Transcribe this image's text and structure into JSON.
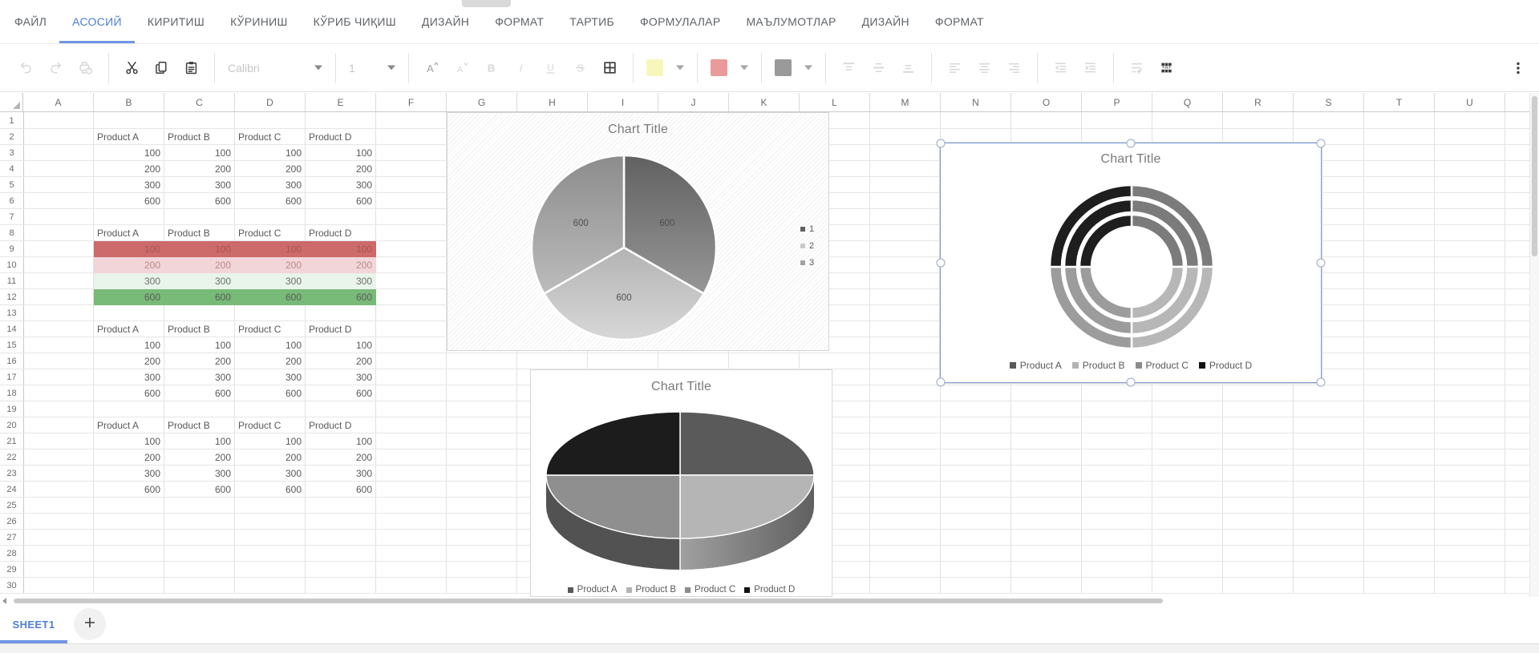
{
  "menu": {
    "active_color": "#4d7cd6",
    "underline_color": "#7295e3",
    "items": [
      {
        "label": "ФАЙЛ",
        "name": "file",
        "active": false
      },
      {
        "label": "АСОСИЙ",
        "name": "home",
        "active": true
      },
      {
        "label": "КИРИТИШ",
        "name": "insert",
        "active": false
      },
      {
        "label": "КЎРИНИШ",
        "name": "view",
        "active": false
      },
      {
        "label": "КЎРИБ ЧИҚИШ",
        "name": "review",
        "active": false
      },
      {
        "label": "ДИЗАЙН",
        "name": "design",
        "active": false
      },
      {
        "label": "ФОРМАТ",
        "name": "format",
        "active": false
      },
      {
        "label": "ТАРТИБ",
        "name": "arrange",
        "active": false
      },
      {
        "label": "ФОРМУЛАЛАР",
        "name": "formulas",
        "active": false
      },
      {
        "label": "МАЪЛУМОТЛАР",
        "name": "data",
        "active": false
      },
      {
        "label": "ДИЗАЙН",
        "name": "design-2",
        "active": false
      },
      {
        "label": "ФОРМАТ",
        "name": "format-2",
        "active": false
      }
    ]
  },
  "toolbar": {
    "font_name": "Calibri",
    "font_size": "1",
    "swatches": {
      "highlight": "#f7f7bb",
      "font_color": "#ea9a9a",
      "shape_fill": "#9a9a9a"
    },
    "groups": [
      {
        "items": [
          {
            "type": "icon",
            "icon": "undo",
            "name": "undo-button",
            "disabled": true
          },
          {
            "type": "icon",
            "icon": "redo",
            "name": "redo-button",
            "disabled": true
          },
          {
            "type": "icon",
            "icon": "print-help",
            "name": "print-help-button",
            "disabled": true
          }
        ]
      },
      {
        "items": [
          {
            "type": "icon",
            "icon": "cut",
            "name": "cut-button",
            "disabled": false
          },
          {
            "type": "icon",
            "icon": "copy",
            "name": "copy-button",
            "disabled": false
          },
          {
            "type": "icon",
            "icon": "paste",
            "name": "paste-button",
            "disabled": false
          }
        ]
      },
      {
        "items": [
          {
            "type": "select",
            "bind": "toolbar.font_name",
            "name": "font-name-select",
            "disabled": true
          }
        ]
      },
      {
        "items": [
          {
            "type": "select",
            "bind": "toolbar.font_size",
            "name": "font-size-select",
            "disabled": true
          }
        ]
      },
      {
        "items": [
          {
            "type": "icon",
            "icon": "font-increase",
            "name": "increase-font-button",
            "disabled": true
          },
          {
            "type": "icon",
            "icon": "font-decrease",
            "name": "decrease-font-button",
            "disabled": true
          },
          {
            "type": "icon",
            "icon": "bold",
            "name": "bold-button",
            "disabled": true
          },
          {
            "type": "icon",
            "icon": "italic",
            "name": "italic-button",
            "disabled": true
          },
          {
            "type": "icon",
            "icon": "underline",
            "name": "underline-button",
            "disabled": true
          },
          {
            "type": "icon",
            "icon": "strikethrough",
            "name": "strikethrough-button",
            "disabled": true
          },
          {
            "type": "icon",
            "icon": "borders",
            "name": "borders-button",
            "disabled": false
          }
        ]
      },
      {
        "items": [
          {
            "type": "swatch",
            "swatch": "highlight",
            "name": "highlight-color-button"
          }
        ]
      },
      {
        "items": [
          {
            "type": "swatch",
            "swatch": "font_color",
            "name": "font-color-button"
          }
        ]
      },
      {
        "items": [
          {
            "type": "swatch",
            "swatch": "shape_fill",
            "name": "shape-fill-color-button"
          }
        ]
      },
      {
        "items": [
          {
            "type": "icon",
            "icon": "valign-top",
            "name": "vertical-align-top-button",
            "disabled": true
          },
          {
            "type": "icon",
            "icon": "valign-middle",
            "name": "vertical-align-middle-button",
            "disabled": true
          },
          {
            "type": "icon",
            "icon": "valign-bottom",
            "name": "vertical-align-bottom-button",
            "disabled": true
          }
        ]
      },
      {
        "items": [
          {
            "type": "icon",
            "icon": "align-left",
            "name": "align-left-button",
            "disabled": true
          },
          {
            "type": "icon",
            "icon": "align-center",
            "name": "align-center-button",
            "disabled": true
          },
          {
            "type": "icon",
            "icon": "align-right",
            "name": "align-right-button",
            "disabled": true
          }
        ]
      },
      {
        "items": [
          {
            "type": "icon",
            "icon": "indent-decrease",
            "name": "indent-decrease-button",
            "disabled": true
          },
          {
            "type": "icon",
            "icon": "indent-increase",
            "name": "indent-increase-button",
            "disabled": true
          }
        ]
      },
      {
        "items": [
          {
            "type": "icon",
            "icon": "wrap-text",
            "name": "wrap-text-button",
            "disabled": true
          },
          {
            "type": "icon",
            "icon": "merge-cells",
            "name": "merge-cells-button",
            "disabled": false
          }
        ]
      }
    ]
  },
  "sheet": {
    "column_headers": [
      "A",
      "B",
      "C",
      "D",
      "E",
      "F",
      "G",
      "H",
      "I",
      "J",
      "K",
      "L",
      "M",
      "N",
      "O",
      "P",
      "Q",
      "R",
      "S",
      "T",
      "U"
    ],
    "visible_rows": 30,
    "product_headers": [
      "Product A",
      "Product B",
      "Product C",
      "Product D"
    ],
    "tables": [
      {
        "name": "table-1",
        "header_row": 2,
        "columns": [
          "B",
          "C",
          "D",
          "E"
        ],
        "rows": [
          {
            "row": 3,
            "values": [
              100,
              100,
              100,
              100
            ]
          },
          {
            "row": 4,
            "values": [
              200,
              200,
              200,
              200
            ]
          },
          {
            "row": 5,
            "values": [
              300,
              300,
              300,
              300
            ]
          },
          {
            "row": 6,
            "values": [
              600,
              600,
              600,
              600
            ]
          }
        ]
      },
      {
        "name": "table-2-conditional-formatting",
        "header_row": 8,
        "columns": [
          "B",
          "C",
          "D",
          "E"
        ],
        "rows": [
          {
            "row": 9,
            "values": [
              100,
              100,
              100,
              100
            ],
            "bg": "#cd6a6a",
            "fg": "#aa5555"
          },
          {
            "row": 10,
            "values": [
              200,
              200,
              200,
              200
            ],
            "bg": "#f2d5d8",
            "fg": "#bb8a8a"
          },
          {
            "row": 11,
            "values": [
              300,
              300,
              300,
              300
            ],
            "bg": "#e9f4ea",
            "fg": "#6d6d6d"
          },
          {
            "row": 12,
            "values": [
              600,
              600,
              600,
              600
            ],
            "bg": "#78ba78",
            "fg": "#5c5c5c"
          }
        ]
      },
      {
        "name": "table-3",
        "header_row": 14,
        "columns": [
          "B",
          "C",
          "D",
          "E"
        ],
        "rows": [
          {
            "row": 15,
            "values": [
              100,
              100,
              100,
              100
            ]
          },
          {
            "row": 16,
            "values": [
              200,
              200,
              200,
              200
            ]
          },
          {
            "row": 17,
            "values": [
              300,
              300,
              300,
              300
            ]
          },
          {
            "row": 18,
            "values": [
              600,
              600,
              600,
              600
            ]
          }
        ]
      },
      {
        "name": "table-4",
        "header_row": 20,
        "columns": [
          "B",
          "C",
          "D",
          "E"
        ],
        "rows": [
          {
            "row": 21,
            "values": [
              100,
              100,
              100,
              100
            ]
          },
          {
            "row": 22,
            "values": [
              200,
              200,
              200,
              200
            ]
          },
          {
            "row": 23,
            "values": [
              300,
              300,
              300,
              300
            ]
          },
          {
            "row": 24,
            "values": [
              600,
              600,
              600,
              600
            ]
          }
        ]
      }
    ]
  },
  "chart_data": [
    {
      "id": "pie-flat",
      "type": "pie",
      "title": "Chart Title",
      "categories": [
        "1",
        "2",
        "3"
      ],
      "values": [
        600,
        600,
        600
      ],
      "data_labels": [
        "600",
        "600",
        "600"
      ],
      "legend": [
        "1",
        "2",
        "3"
      ],
      "legend_position": "right",
      "background": "hatched",
      "colors_top": [
        "#616161",
        "#b3b3b3",
        "#8c8c8c"
      ],
      "colors_bottom": [
        "#979797",
        "#d8d8d8",
        "#bcbcbc"
      ],
      "legend_colors": [
        "#616161",
        "#c9c9c9",
        "#a3a3a3"
      ]
    },
    {
      "id": "doughnut",
      "type": "doughnut",
      "title": "Chart Title",
      "categories": [
        "Product A",
        "Product B",
        "Product C",
        "Product D"
      ],
      "series": [
        {
          "name": "ring-inner",
          "values": [
            100,
            100,
            100,
            100
          ]
        },
        {
          "name": "ring-middle",
          "values": [
            200,
            200,
            200,
            200
          ]
        },
        {
          "name": "ring-outer",
          "values": [
            300,
            300,
            300,
            300
          ]
        }
      ],
      "legend": [
        "Product A",
        "Product B",
        "Product C",
        "Product D"
      ],
      "legend_position": "bottom",
      "selected": true,
      "colors": [
        "#7b7b7b",
        "#b7b7b7",
        "#9c9c9c",
        "#1e1e1e"
      ],
      "legend_colors": [
        "#595959",
        "#b3b3b3",
        "#8c8c8c",
        "#111111"
      ]
    },
    {
      "id": "pie-3d",
      "type": "pie3d",
      "title": "Chart Title",
      "categories": [
        "Product A",
        "Product B",
        "Product C",
        "Product D"
      ],
      "values": [
        100,
        100,
        100,
        100
      ],
      "legend": [
        "Product A",
        "Product B",
        "Product C",
        "Product D"
      ],
      "legend_position": "bottom",
      "colors": [
        "#5a5a5a",
        "#b5b5b5",
        "#8f8f8f",
        "#1c1c1c"
      ],
      "legend_colors": [
        "#595959",
        "#b3b3b3",
        "#8c8c8c",
        "#111111"
      ]
    }
  ],
  "sheet_bar": {
    "tabs": [
      {
        "label": "SHEET1",
        "active": true
      }
    ]
  }
}
